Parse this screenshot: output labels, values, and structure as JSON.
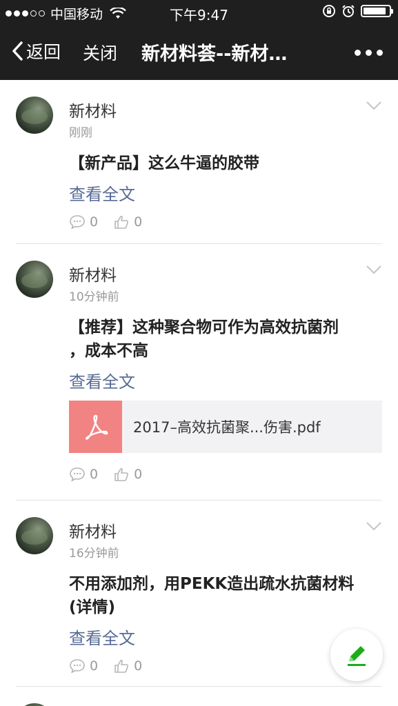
{
  "status_bar": {
    "carrier": "中国移动",
    "time": "下午9:47",
    "battery_level": 0.9
  },
  "nav": {
    "back_label": "返回",
    "close_label": "关闭",
    "title": "新材料荟--新材…"
  },
  "posts": [
    {
      "author": "新材料",
      "time": "刚刚",
      "title_lines": [
        "【新产品】这么牛逼的胶带"
      ],
      "read_more": "查看全文",
      "comments": "0",
      "likes": "0"
    },
    {
      "author": "新材料",
      "time": "10分钟前",
      "title_lines": [
        "【推荐】这种聚合物可作为高效抗菌剂",
        "，成本不高"
      ],
      "read_more": "查看全文",
      "attachment": "2017–高效抗菌聚...伤害.pdf",
      "comments": "0",
      "likes": "0"
    },
    {
      "author": "新材料",
      "time": "16分钟前",
      "title_lines": [
        "不用添加剂，用PEKK造出疏水抗菌材料",
        "(详情)"
      ],
      "read_more": "查看全文",
      "comments": "0",
      "likes": "0"
    }
  ],
  "colors": {
    "link": "#576b95",
    "pdf_badge": "#f28383",
    "fab_pencil": "#1aad19",
    "bar_bg": "#1f1f1f"
  }
}
